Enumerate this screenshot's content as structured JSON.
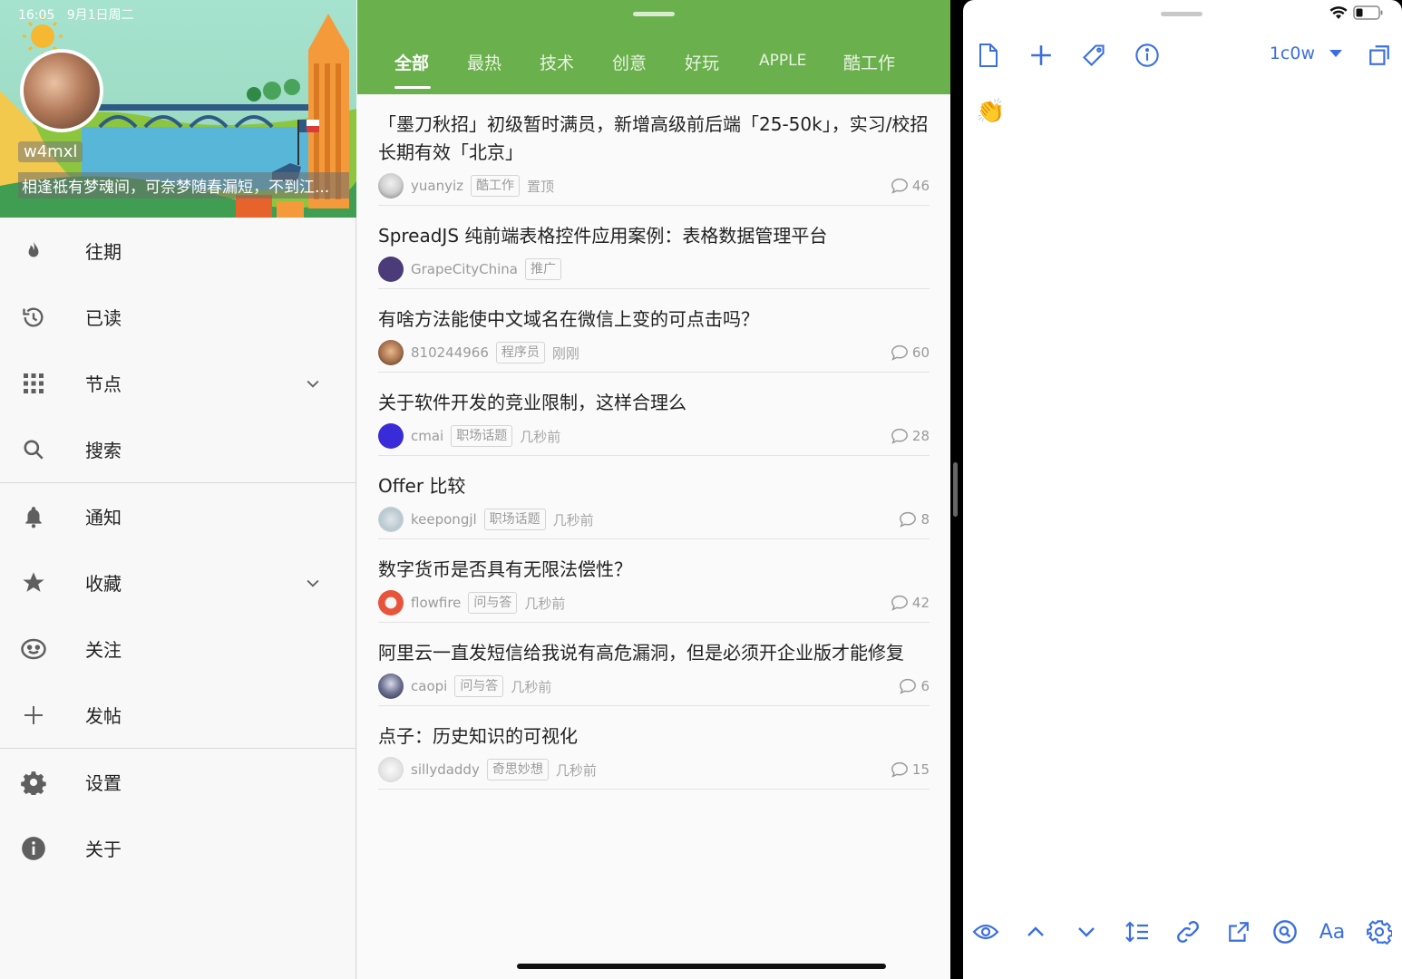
{
  "status_bar": {
    "time": "16:05",
    "date": "9月1日周二"
  },
  "drawer": {
    "username": "w4mxl",
    "signature": "相逢祗有梦魂间，可奈梦随春漏短，不到江...",
    "menu": [
      {
        "label": "往期",
        "icon": "fire-icon"
      },
      {
        "label": "已读",
        "icon": "history-icon"
      },
      {
        "label": "节点",
        "icon": "grid-icon",
        "expandable": true
      },
      {
        "label": "搜索",
        "icon": "search-icon"
      },
      {
        "label": "通知",
        "icon": "bell-icon"
      },
      {
        "label": "收藏",
        "icon": "star-icon",
        "expandable": true
      },
      {
        "label": "关注",
        "icon": "smile-icon"
      },
      {
        "label": "发帖",
        "icon": "plus-icon"
      },
      {
        "label": "设置",
        "icon": "gear-icon"
      },
      {
        "label": "关于",
        "icon": "info-icon"
      }
    ]
  },
  "tabs": [
    "全部",
    "最热",
    "技术",
    "创意",
    "好玩",
    "APPLE",
    "酷工作"
  ],
  "active_tab": "全部",
  "topics": [
    {
      "title": "「墨刀秋招」初级暂时满员，新增高级前后端「25-50k」，实习/校招长期有效「北京」",
      "user": "yuanyiz",
      "node": "酷工作",
      "time": "置顶",
      "replies": "46"
    },
    {
      "title": "SpreadJS 纯前端表格控件应用案例：表格数据管理平台",
      "user": "GrapeCityChina",
      "node": "推广",
      "time": "",
      "replies": ""
    },
    {
      "title": "有啥方法能使中文域名在微信上变的可点击吗？",
      "user": "810244966",
      "node": "程序员",
      "time": "刚刚",
      "replies": "60"
    },
    {
      "title": "关于软件开发的竞业限制，这样合理么",
      "user": "cmai",
      "node": "职场话题",
      "time": "几秒前",
      "replies": "28"
    },
    {
      "title": "Offer 比较",
      "user": "keepongjl",
      "node": "职场话题",
      "time": "几秒前",
      "replies": "8"
    },
    {
      "title": "数字货币是否具有无限法偿性？",
      "user": "flowfire",
      "node": "问与答",
      "time": "几秒前",
      "replies": "42"
    },
    {
      "title": "阿里云一直发短信给我说有高危漏洞，但是必须开企业版才能修复",
      "user": "caopi",
      "node": "问与答",
      "time": "几秒前",
      "replies": "6"
    },
    {
      "title": "点子：历史知识的可视化",
      "user": "sillydaddy",
      "node": "奇思妙想",
      "time": "几秒前",
      "replies": "15"
    }
  ],
  "colors": {
    "tab_bar": "#6ab04c",
    "accent_blue": "#3b6fe0"
  },
  "right_app": {
    "user_selector": "1c0w",
    "content_emoji": "👏",
    "top_toolbar": [
      "new-document-icon",
      "plus-icon",
      "tag-icon",
      "info-icon"
    ],
    "bottom_toolbar": [
      "eye-icon",
      "chevron-up-icon",
      "chevron-down-icon",
      "line-spacing-icon",
      "link-icon",
      "share-icon",
      "search-icon",
      "font-icon",
      "gear-icon"
    ],
    "font_label": "Aa"
  }
}
